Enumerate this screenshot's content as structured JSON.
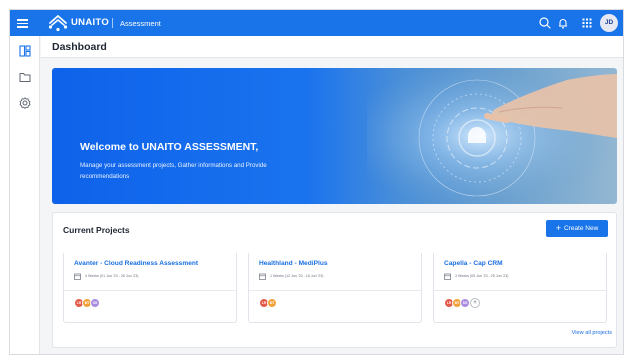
{
  "topbar": {
    "brand": "UNAITO",
    "app_name": "Assessment",
    "user_initials": "JD"
  },
  "page": {
    "title": "Dashboard"
  },
  "banner": {
    "title": "Welcome to UNAITO ASSESSMENT,",
    "description": "Manage your assessment projects, Gather informations and Provide recommendations"
  },
  "projects": {
    "section_title": "Current Projects",
    "create_label": "Create New",
    "view_all_label": "View all projects",
    "items": [
      {
        "title": "Avanter - Cloud Readiness Assessment",
        "meta": "4 Weeks (01 Jun '23 - 28 Jun '23)",
        "members": [
          {
            "initials": "LR",
            "color": "#e25c4b"
          },
          {
            "initials": "MT",
            "color": "#f2a23a"
          },
          {
            "initials": "SG",
            "color": "#a98be0"
          }
        ],
        "more": ""
      },
      {
        "title": "Healthland - MediPlus",
        "meta": "1 Weeks (12 Jun '23 - 18 Jun '23)",
        "members": [
          {
            "initials": "LR",
            "color": "#e25c4b"
          },
          {
            "initials": "MT",
            "color": "#f2a23a"
          }
        ],
        "more": ""
      },
      {
        "title": "Capella - Cap CRM",
        "meta": "3 Weeks (05 Jun '23 - 25 Jun '23)",
        "members": [
          {
            "initials": "LR",
            "color": "#e25c4b"
          },
          {
            "initials": "MT",
            "color": "#f2a23a"
          },
          {
            "initials": "SG",
            "color": "#a98be0"
          }
        ],
        "more": "+"
      }
    ]
  },
  "colors": {
    "primary": "#1874e8",
    "link": "#1a6fe0",
    "background": "#f4f5f7"
  },
  "icons": {
    "menu": "hamburger-icon",
    "search": "search-icon",
    "notifications": "bell-icon",
    "apps": "grid-icon",
    "dashboard": "dashboard-icon",
    "folder": "folder-icon",
    "settings": "gear-icon",
    "calendar": "calendar-icon"
  }
}
